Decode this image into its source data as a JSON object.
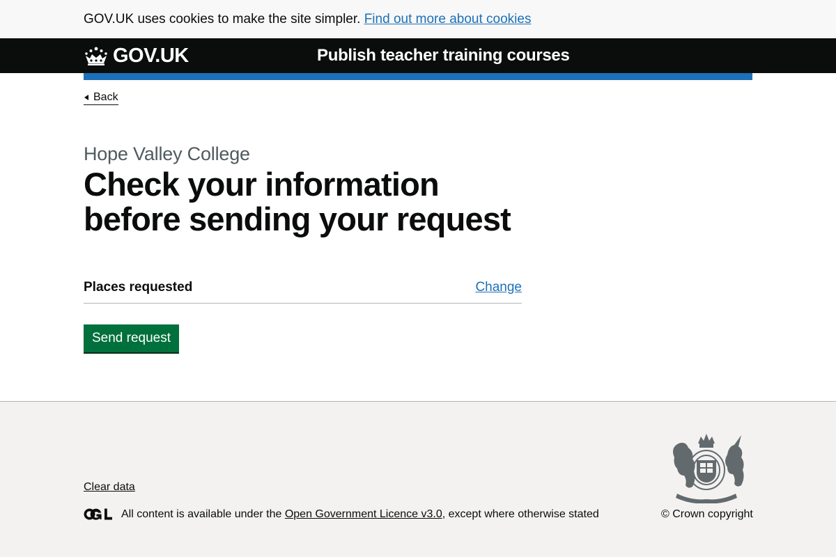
{
  "cookie_banner": {
    "message": "GOV.UK uses cookies to make the site simpler.",
    "link_text": "Find out more about cookies"
  },
  "header": {
    "logo_text": "GOV.UK",
    "logo_icon": "crown-icon",
    "service_name": "Publish teacher training courses"
  },
  "back_link": {
    "label": "Back",
    "icon": "chevron-left-icon"
  },
  "page": {
    "caption": "Hope Valley College",
    "title": "Check your information before sending your request"
  },
  "summary": [
    {
      "key": "Places requested",
      "action": "Change"
    }
  ],
  "actions": {
    "submit_label": "Send request"
  },
  "footer": {
    "clear_data": "Clear data",
    "licence_prefix": "All content is available under the",
    "licence_link": "Open Government Licence v3.0",
    "licence_suffix": ", except where otherwise stated",
    "copyright": "© Crown copyright",
    "ogl_logo": "ogl-logo-icon",
    "crest_logo": "royal-coat-of-arms-icon"
  },
  "colors": {
    "brand_blue": "#1d70b8",
    "header_black": "#0b0c0c",
    "button_green": "#00703c",
    "footer_grey": "#f3f2f1",
    "caption_grey": "#505a5f"
  }
}
